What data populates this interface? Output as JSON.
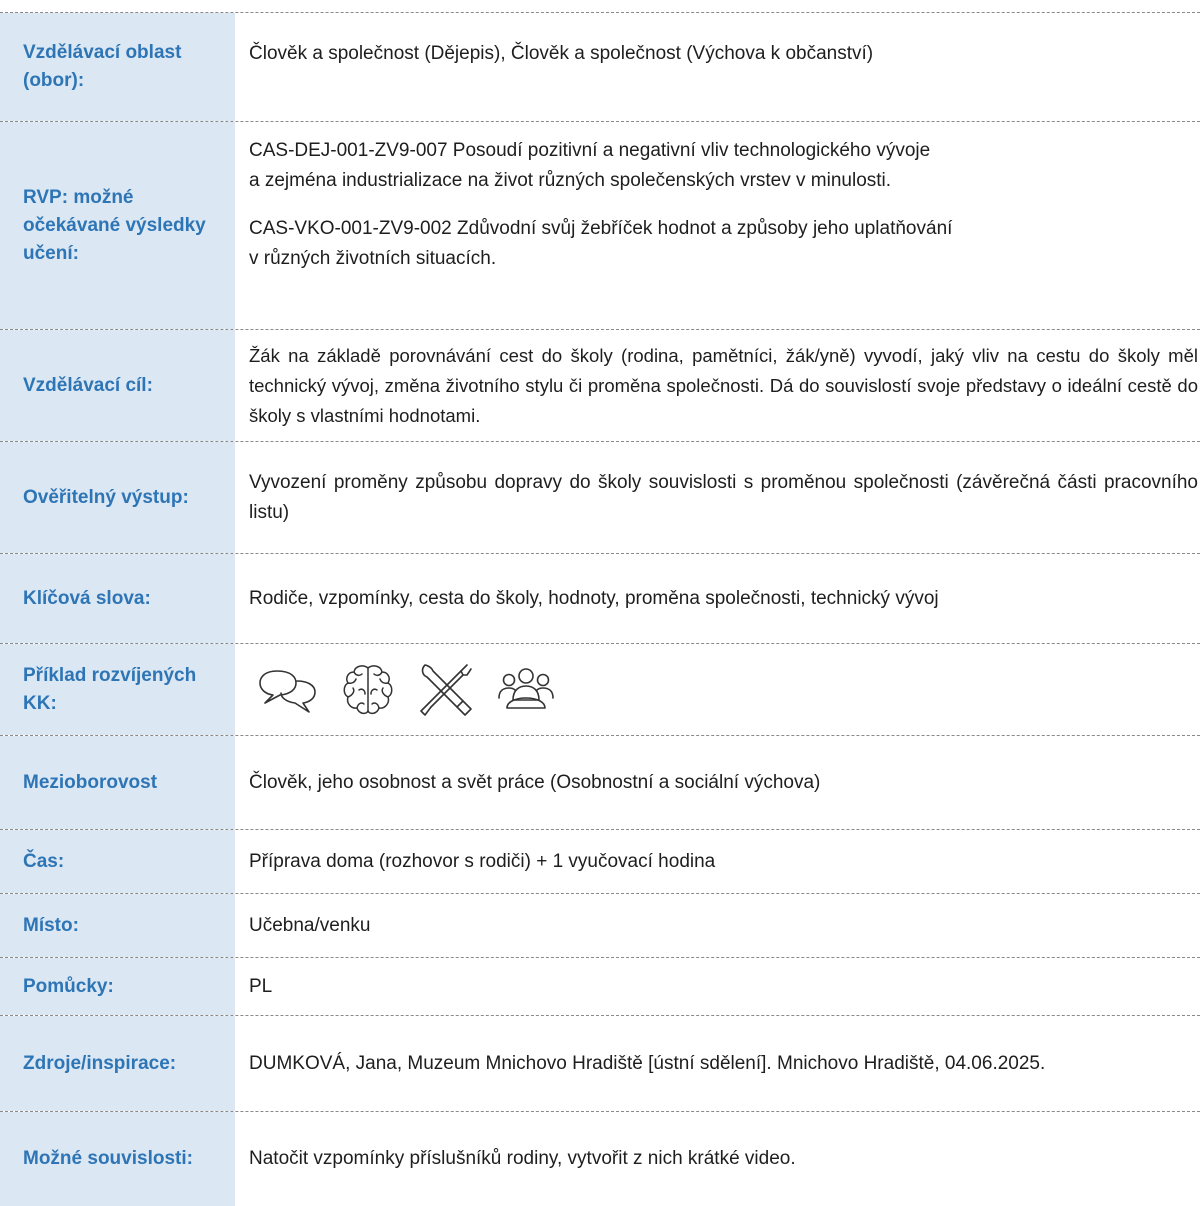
{
  "rows": {
    "oblast": {
      "label": "Vzdělávací oblast (obor):",
      "value": "Člověk a společnost (Dějepis), Člověk a společnost (Výchova k občanství)"
    },
    "rvp": {
      "label": "RVP: možné očekávané výsledky učení:",
      "line1a": "CAS-DEJ-001-ZV9-007 Posoudí pozitivní a negativní vliv technologického vývoje",
      "line1b": "a zejména industrializace na život různých společenských vrstev v minulosti.",
      "line2a": "CAS-VKO-001-ZV9-002 Zdůvodní svůj žebříček hodnot a způsoby jeho uplatňování",
      "line2b": "v různých životních situacích."
    },
    "cil": {
      "label": "Vzdělávací cíl:",
      "value": "Žák na základě porovnávání cest do školy (rodina, pamětníci, žák/yně) vyvodí, jaký vliv na cestu do školy měl technický vývoj, změna životního stylu či proměna společnosti. Dá do souvislostí svoje představy o ideální cestě do školy s vlastními hodnotami."
    },
    "vystup": {
      "label": "Ověřitelný výstup:",
      "value": "Vyvození proměny způsobu dopravy do školy souvislosti s proměnou společnosti (závěrečná části pracovního listu)"
    },
    "slova": {
      "label": "Klíčová slova:",
      "value": "Rodiče, vzpomínky, cesta do školy, hodnoty, proměna společnosti, technický vývoj"
    },
    "kk": {
      "label": "Příklad rozvíjených KK:",
      "icons": [
        "speech-bubbles-icon",
        "brain-icon",
        "tools-icon",
        "people-group-icon"
      ]
    },
    "mezi": {
      "label": "Mezioborovost",
      "value": "Člověk, jeho osobnost a svět práce (Osobnostní a sociální výchova)"
    },
    "cas": {
      "label": "Čas:",
      "value": "Příprava doma (rozhovor s rodiči) + 1 vyučovací hodina"
    },
    "misto": {
      "label": "Místo:",
      "value": "Učebna/venku"
    },
    "pomucky": {
      "label": "Pomůcky:",
      "value": "PL"
    },
    "zdroje": {
      "label": "Zdroje/inspirace:",
      "value": "DUMKOVÁ, Jana, Muzeum Mnichovo Hradiště [ústní sdělení]. Mnichovo Hradiště, 04.06.2025."
    },
    "souvislosti": {
      "label": "Možné souvislosti:",
      "value": "Natočit vzpomínky příslušníků rodiny, vytvořit z nich krátké video."
    }
  },
  "colors": {
    "label_background": "#dbe7f3",
    "label_text": "#2e75b6",
    "body_text": "#1e1e1e",
    "divider": "#8a8a8a"
  }
}
